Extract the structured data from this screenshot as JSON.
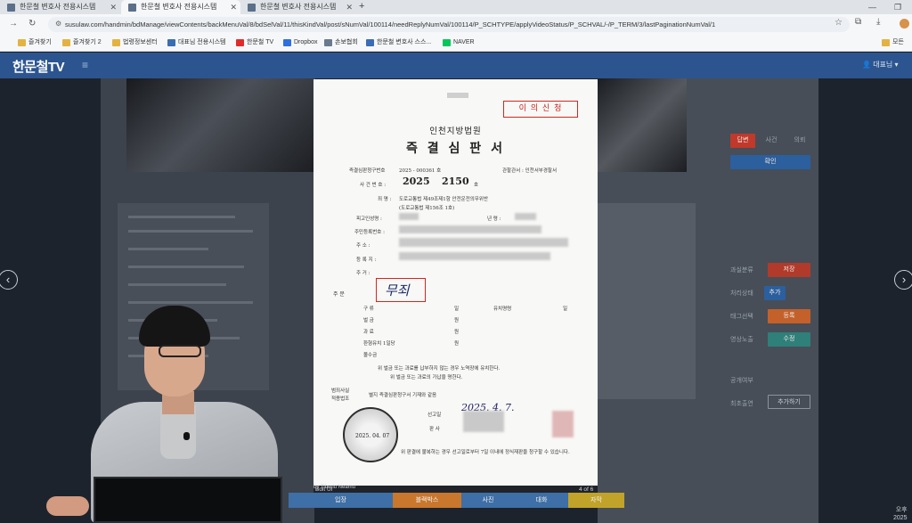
{
  "browser": {
    "tabs": [
      {
        "label": "한문철 변호사 전용시스템"
      },
      {
        "label": "한문철 변호사 전용시스템"
      },
      {
        "label": "한문철 변호사 전용시스템"
      }
    ],
    "new_tab": "+",
    "url": "susulaw.com/handmin/bdManage/viewContents/backMenuVal/8/bdSelVal/11/thisKindVal/post/sNumVal/100114/needReplyNumVal/100114/P_SCHTYPE/applyVideoStatus/P_SCHVAL/-/P_TERM/3/lastPaginationNumVal/1",
    "bookmarks": [
      {
        "label": "즐겨찾기",
        "color": "#e3b341"
      },
      {
        "label": "즐겨찾기 2",
        "color": "#e3b341"
      },
      {
        "label": "법령정보센터",
        "color": "#e3b341"
      },
      {
        "label": "대표님 전용시스템",
        "color": "#3a6db3"
      },
      {
        "label": "한문철 TV",
        "color": "#e02b2b"
      },
      {
        "label": "Dropbox",
        "color": "#2f6fe0"
      },
      {
        "label": "손보협회",
        "color": "#6b7a8f"
      },
      {
        "label": "한문철 변호사 스스...",
        "color": "#3a6db3"
      },
      {
        "label": "NAVER",
        "color": "#03c75a"
      }
    ],
    "bookmarks_other": "모든"
  },
  "site": {
    "logo": "한문철TV",
    "user": "대표님"
  },
  "document": {
    "appeal_label": "이 의 신 청",
    "court": "인천지방법원",
    "title": "즉 결 심 판 서",
    "request_no_label": "즉결심판청구번호",
    "request_no": "2025 - 000361 호",
    "police_label": "관할관서 : 인천서부경찰서",
    "case_no_label": "사 건 번 호 :",
    "case_year": "2025",
    "case_number": "2150",
    "case_suffix": "호",
    "charge_label": "죄 명 :",
    "charge_text": "도로교통법 제49조제1항 안전운전의무위반",
    "charge_sub": "(도로교통법 제156조 1호)",
    "defendant_label": "피고인성명 :",
    "age_label": "년 령 :",
    "resident_label": "주민등록번호 :",
    "address_label": "주 소 :",
    "registry_label": "등 록 지 :",
    "residence_label": "주 거 :",
    "verdict_label": "주 문",
    "verdict": "무죄",
    "rows": [
      "구 류",
      "벌 금",
      "과 료",
      "환형유치 1일당",
      "몰수금"
    ],
    "unit_day": "일",
    "unit_won": "원",
    "detention_label": "유치명령",
    "note_1": "위 벌금 또는 과료를 납부하지 않는 경우 노역장에 유치한다.",
    "note_2": "위 벌금 또는 과료의 가납을 명한다.",
    "evidence_label": "범죄사실",
    "evidence_label_2": "적용법조",
    "evidence_note": "별지 즉결심판청구서 기재와 같음",
    "date_label": "선고일",
    "judge_label": "판 사",
    "seal_date": "2025. 04. 07",
    "footer_note": "위 판결에 불복하는 경우 선고일로부터 7일 이내에 정식재판을 청구할 수 있습니다."
  },
  "viewer": {
    "source": "Bolt UI",
    "author": "by Tiberiu Neamu",
    "page": "4 of 6"
  },
  "toolbar": [
    {
      "label": "입장",
      "color": "#3e6fa6"
    },
    {
      "label": "블랙박스",
      "color": "#c8772d"
    },
    {
      "label": "사진",
      "color": "#3e6fa6"
    },
    {
      "label": "대화",
      "color": "#3e6fa6"
    },
    {
      "label": "자막",
      "color": "#c2a32a"
    }
  ],
  "right_panel": {
    "tabs": [
      "답변",
      "사건",
      "의뢰"
    ],
    "items": [
      "과실분류",
      "처리상태",
      "태그선택",
      "영상노출",
      "공개여부",
      "최초출연"
    ],
    "buttons": [
      "확인",
      "저장",
      "추가",
      "등록",
      "수정",
      "추가하기"
    ]
  },
  "clock": {
    "line1": "오후",
    "line2": "2025"
  }
}
